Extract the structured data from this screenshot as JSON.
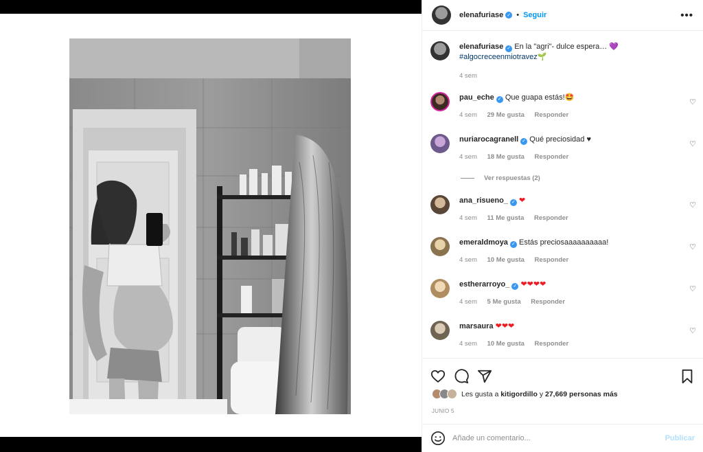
{
  "post": {
    "author": "elenafuriase",
    "follow_label": "Seguir",
    "more_label": "•••",
    "separator": "•",
    "caption": "En la \"agri\"- dulce espera…",
    "caption_emoji": "💜",
    "hashtag": "#algocreceenmiotravez",
    "hashtag_emoji": "🌱",
    "caption_time": "4 sem",
    "photo_alt": "Foto en blanco y negro"
  },
  "comments": [
    {
      "user": "pau_eche",
      "text": "Que guapa estás!",
      "emoji": "🤩",
      "time": "4 sem",
      "likes": "29 Me gusta",
      "reply": "Responder"
    },
    {
      "user": "nuriarocagranell",
      "text": "Qué preciosidad",
      "emoji": "♥",
      "time": "4 sem",
      "likes": "18 Me gusta",
      "reply": "Responder"
    },
    {
      "user": "ana_risueno_",
      "text": "",
      "emoji": "❤",
      "time": "4 sem",
      "likes": "11 Me gusta",
      "reply": "Responder"
    },
    {
      "user": "emeraldmoya",
      "text": "Estás preciosaaaaaaaaaa!",
      "emoji": "",
      "time": "4 sem",
      "likes": "10 Me gusta",
      "reply": "Responder"
    },
    {
      "user": "estherarroyo_",
      "text": "",
      "emoji": "❤❤❤❤",
      "time": "4 sem",
      "likes": "5 Me gusta",
      "reply": "Responder"
    },
    {
      "user": "marsaura",
      "text": "",
      "emoji": "❤❤❤",
      "time": "4 sem",
      "likes": "10 Me gusta",
      "reply": "Responder"
    }
  ],
  "view_replies": "Ver respuestas (2)",
  "likes": {
    "prefix": "Les gusta a",
    "user": "kitigordillo",
    "conj": "y",
    "count": "27,669 personas más"
  },
  "date": "JUNIO 5",
  "add_comment": {
    "placeholder": "Añade un comentario...",
    "post_label": "Publicar"
  },
  "icons": {
    "like": "heart-outline-icon",
    "comment": "comment-bubble-icon",
    "share": "paper-plane-icon",
    "save": "bookmark-icon",
    "emoji": "smiley-icon",
    "verified": "verified-badge-icon"
  },
  "colors": {
    "link_blue": "#0095f6",
    "verified_blue": "#3897f0",
    "muted": "#8e8e8e",
    "heart_red": "#ed1c24",
    "hashtag": "#00376b"
  }
}
